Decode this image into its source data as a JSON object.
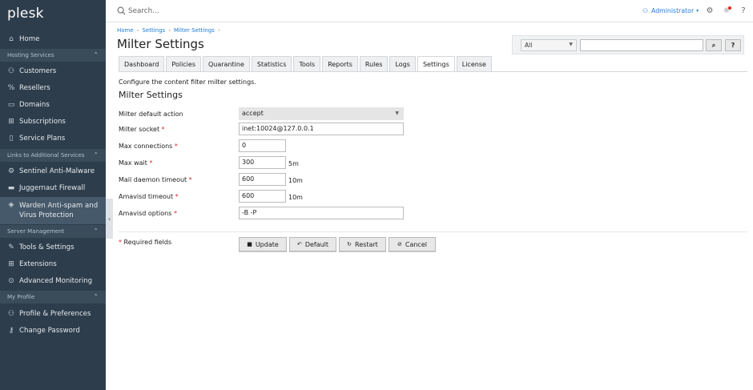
{
  "app": {
    "logo": "plesk"
  },
  "sidebar": {
    "home": "Home",
    "hosting_services": {
      "title": "Hosting Services",
      "items": [
        "Customers",
        "Resellers",
        "Domains",
        "Subscriptions",
        "Service Plans"
      ]
    },
    "additional_services": {
      "title": "Links to Additional Services",
      "items": [
        "Sentinel Anti-Malware",
        "Juggernaut Firewall",
        "Warden Anti-spam and Virus Protection"
      ]
    },
    "server_management": {
      "title": "Server Management",
      "items": [
        "Tools & Settings",
        "Extensions",
        "Advanced Monitoring"
      ]
    },
    "my_profile": {
      "title": "My Profile",
      "items": [
        "Profile & Preferences",
        "Change Password"
      ]
    }
  },
  "topbar": {
    "search_placeholder": "Search...",
    "user": "Administrator"
  },
  "breadcrumb": [
    "Home",
    "Settings",
    "Milter Settings"
  ],
  "page": {
    "title": "Milter Settings",
    "filter_selected": "All"
  },
  "tabs": [
    "Dashboard",
    "Policies",
    "Quarantine",
    "Statistics",
    "Tools",
    "Reports",
    "Rules",
    "Logs",
    "Settings",
    "License"
  ],
  "active_tab": "Settings",
  "form": {
    "description": "Configure the content filter milter settings.",
    "section_title": "Milter Settings",
    "default_action": {
      "label": "Milter default action",
      "value": "accept"
    },
    "socket": {
      "label": "Milter socket",
      "value": "inet:10024@127.0.0.1"
    },
    "max_connections": {
      "label": "Max connections",
      "value": "0"
    },
    "max_wait": {
      "label": "Max wait",
      "value": "300",
      "unit": "5m"
    },
    "mail_daemon_timeout": {
      "label": "Mail daemon timeout",
      "value": "600",
      "unit": "10m"
    },
    "amavisd_timeout": {
      "label": "Amavisd timeout",
      "value": "600",
      "unit": "10m"
    },
    "amavisd_options": {
      "label": "Amavisd options",
      "value": "-B -P"
    },
    "required_note": "Required fields",
    "required_mark": "*"
  },
  "buttons": {
    "update": "Update",
    "default": "Default",
    "restart": "Restart",
    "cancel": "Cancel"
  },
  "colors": {
    "sidebar_bg": "#2d3d4c",
    "accent": "#1f7bd8",
    "required": "#e02424"
  }
}
